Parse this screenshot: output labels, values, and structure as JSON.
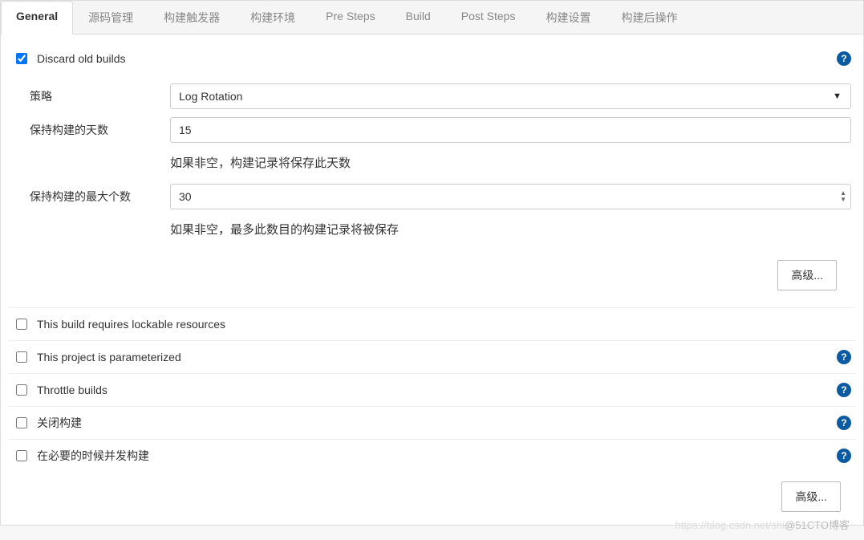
{
  "tabs": {
    "general": "General",
    "scm": "源码管理",
    "triggers": "构建触发器",
    "env": "构建环境",
    "pre": "Pre Steps",
    "build": "Build",
    "post": "Post Steps",
    "settings": "构建设置",
    "post_actions": "构建后操作"
  },
  "discard": {
    "label": "Discard old builds",
    "strategy_label": "策略",
    "strategy_value": "Log Rotation",
    "days_label": "保持构建的天数",
    "days_value": "15",
    "days_hint": "如果非空，构建记录将保存此天数",
    "max_label": "保持构建的最大个数",
    "max_value": "30",
    "max_hint": "如果非空，最多此数目的构建记录将被保存"
  },
  "opts": {
    "lockable": "This build requires lockable resources",
    "parameterized": "This project is parameterized",
    "throttle": "Throttle builds",
    "disable": "关闭构建",
    "concurrent": "在必要的时候并发构建"
  },
  "buttons": {
    "advanced": "高级..."
  },
  "help_glyph": "?",
  "watermark": {
    "faint": "https://blog.csdn.net/shi",
    "text": "@51CTO博客"
  }
}
